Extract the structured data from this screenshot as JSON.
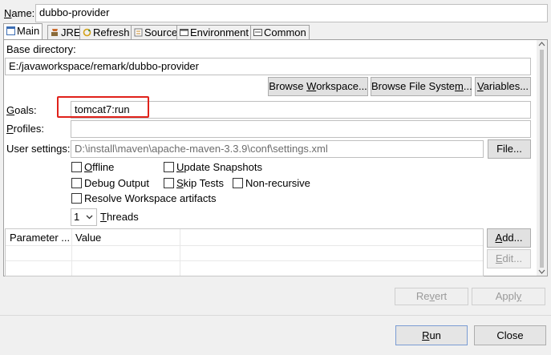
{
  "name": {
    "label": "Name:",
    "value": "dubbo-provider"
  },
  "tabs": [
    {
      "label": "Main",
      "icon": "main-tab-icon"
    },
    {
      "label": "JRE",
      "icon": "jre-icon"
    },
    {
      "label": "Refresh",
      "icon": "refresh-icon"
    },
    {
      "label": "Source",
      "icon": "source-icon"
    },
    {
      "label": "Environment",
      "icon": "environment-icon"
    },
    {
      "label": "Common",
      "icon": "common-icon"
    }
  ],
  "base_directory": {
    "label": "Base directory:",
    "value": "E:/javaworkspace/remark/dubbo-provider",
    "browse_workspace": "Browse Workspace...",
    "browse_filesystem": "Browse File System...",
    "variables": "Variables..."
  },
  "goals": {
    "label": "Goals:",
    "value": "tomcat7:run"
  },
  "profiles": {
    "label": "Profiles:",
    "value": ""
  },
  "user_settings": {
    "label": "User settings:",
    "value": "D:\\install\\maven\\apache-maven-3.3.9\\conf\\settings.xml",
    "file_button": "File..."
  },
  "options": {
    "offline": "Offline",
    "update_snapshots": "Update Snapshots",
    "debug_output": "Debug Output",
    "skip_tests": "Skip Tests",
    "non_recursive": "Non-recursive",
    "resolve_workspace": "Resolve Workspace artifacts"
  },
  "threads": {
    "value": "1",
    "label": "Threads"
  },
  "parameters": {
    "columns": [
      "Parameter ...",
      "Value"
    ],
    "add_button": "Add...",
    "edit_button": "Edit..."
  },
  "footer": {
    "revert": "Revert",
    "apply": "Apply",
    "run": "Run",
    "close": "Close"
  },
  "colors": {
    "highlight": "#e0221b",
    "panel_background": "#ffffff",
    "dialog_background": "#f0f0f0"
  }
}
